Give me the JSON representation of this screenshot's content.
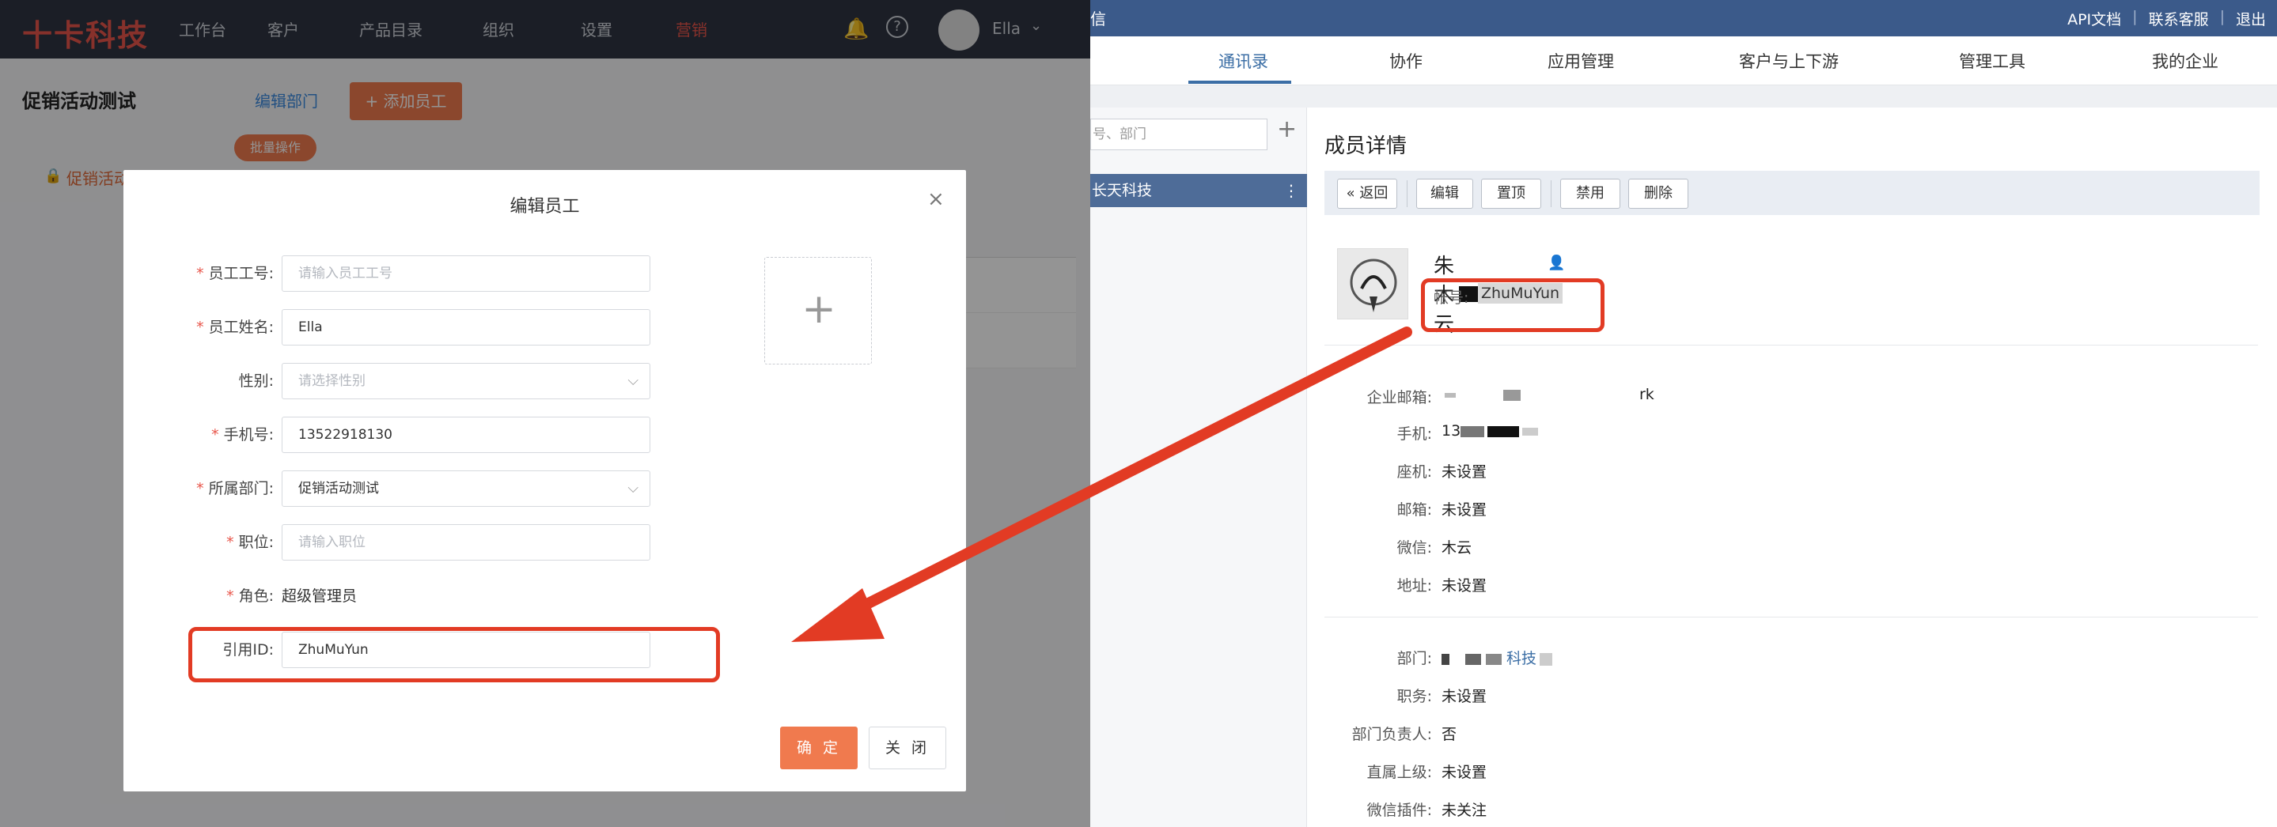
{
  "left_app": {
    "logo": "十卡科技",
    "nav": [
      "工作台",
      "客户",
      "产品目录",
      "组织",
      "设置",
      "营销"
    ],
    "user_name": "Ella",
    "department_title": "促销活动测试",
    "department_edit": "编辑部门",
    "add_employee_button": "+ 添加员工",
    "bulk_button": "批量操作",
    "tree_item": "促销活动测试"
  },
  "modal": {
    "title": "编辑员工",
    "fields": {
      "employee_no": {
        "label": "员工工号:",
        "required": true,
        "value": "",
        "placeholder": "请输入员工工号"
      },
      "employee_name": {
        "label": "员工姓名:",
        "required": true,
        "value": "Ella",
        "placeholder": ""
      },
      "gender": {
        "label": "性别:",
        "required": false,
        "value": "",
        "placeholder": "请选择性别"
      },
      "phone": {
        "label": "手机号:",
        "required": true,
        "value": "13522918130",
        "placeholder": ""
      },
      "department": {
        "label": "所属部门:",
        "required": true,
        "value": "促销活动测试",
        "placeholder": ""
      },
      "position": {
        "label": "职位:",
        "required": true,
        "value": "",
        "placeholder": "请输入职位"
      },
      "role": {
        "label": "角色:",
        "required": true,
        "value": "超级管理员"
      },
      "ref_id": {
        "label": "引用ID:",
        "required": false,
        "value": "ZhuMuYun",
        "placeholder": ""
      }
    },
    "ok_button": "确 定",
    "close_button": "关 闭"
  },
  "right_app": {
    "top_left": "信",
    "top_links": [
      "API文档",
      "联系客服",
      "退出"
    ],
    "tabs": [
      "通讯录",
      "协作",
      "应用管理",
      "客户与上下游",
      "管理工具",
      "我的企业"
    ],
    "active_tab": "通讯录",
    "search_placeholder": "号、部门",
    "org_name": "长天科技",
    "detail_title": "成员详情",
    "toolbar": {
      "back": "返回",
      "edit": "编辑",
      "pin": "置顶",
      "disable": "禁用",
      "delete": "删除"
    },
    "member_name": "朱木云",
    "account_label": "帐号:",
    "account_value": "ZhuMuYun",
    "details_1": [
      {
        "label": "企业邮箱:",
        "value": "rk"
      },
      {
        "label": "手机:",
        "value": "13"
      },
      {
        "label": "座机:",
        "value": "未设置"
      },
      {
        "label": "邮箱:",
        "value": "未设置"
      },
      {
        "label": "微信:",
        "value": "木云"
      },
      {
        "label": "地址:",
        "value": "未设置"
      }
    ],
    "details_2": [
      {
        "label": "部门:",
        "value": "科技"
      },
      {
        "label": "职务:",
        "value": "未设置"
      },
      {
        "label": "部门负责人:",
        "value": "否"
      },
      {
        "label": "直属上级:",
        "value": "未设置"
      },
      {
        "label": "微信插件:",
        "value": "未关注"
      }
    ]
  },
  "colors": {
    "primary_orange": "#f07a4e",
    "highlight_red": "#e23b24",
    "right_header_blue": "#3b5a8a",
    "active_tab_blue": "#3b6ea5"
  }
}
